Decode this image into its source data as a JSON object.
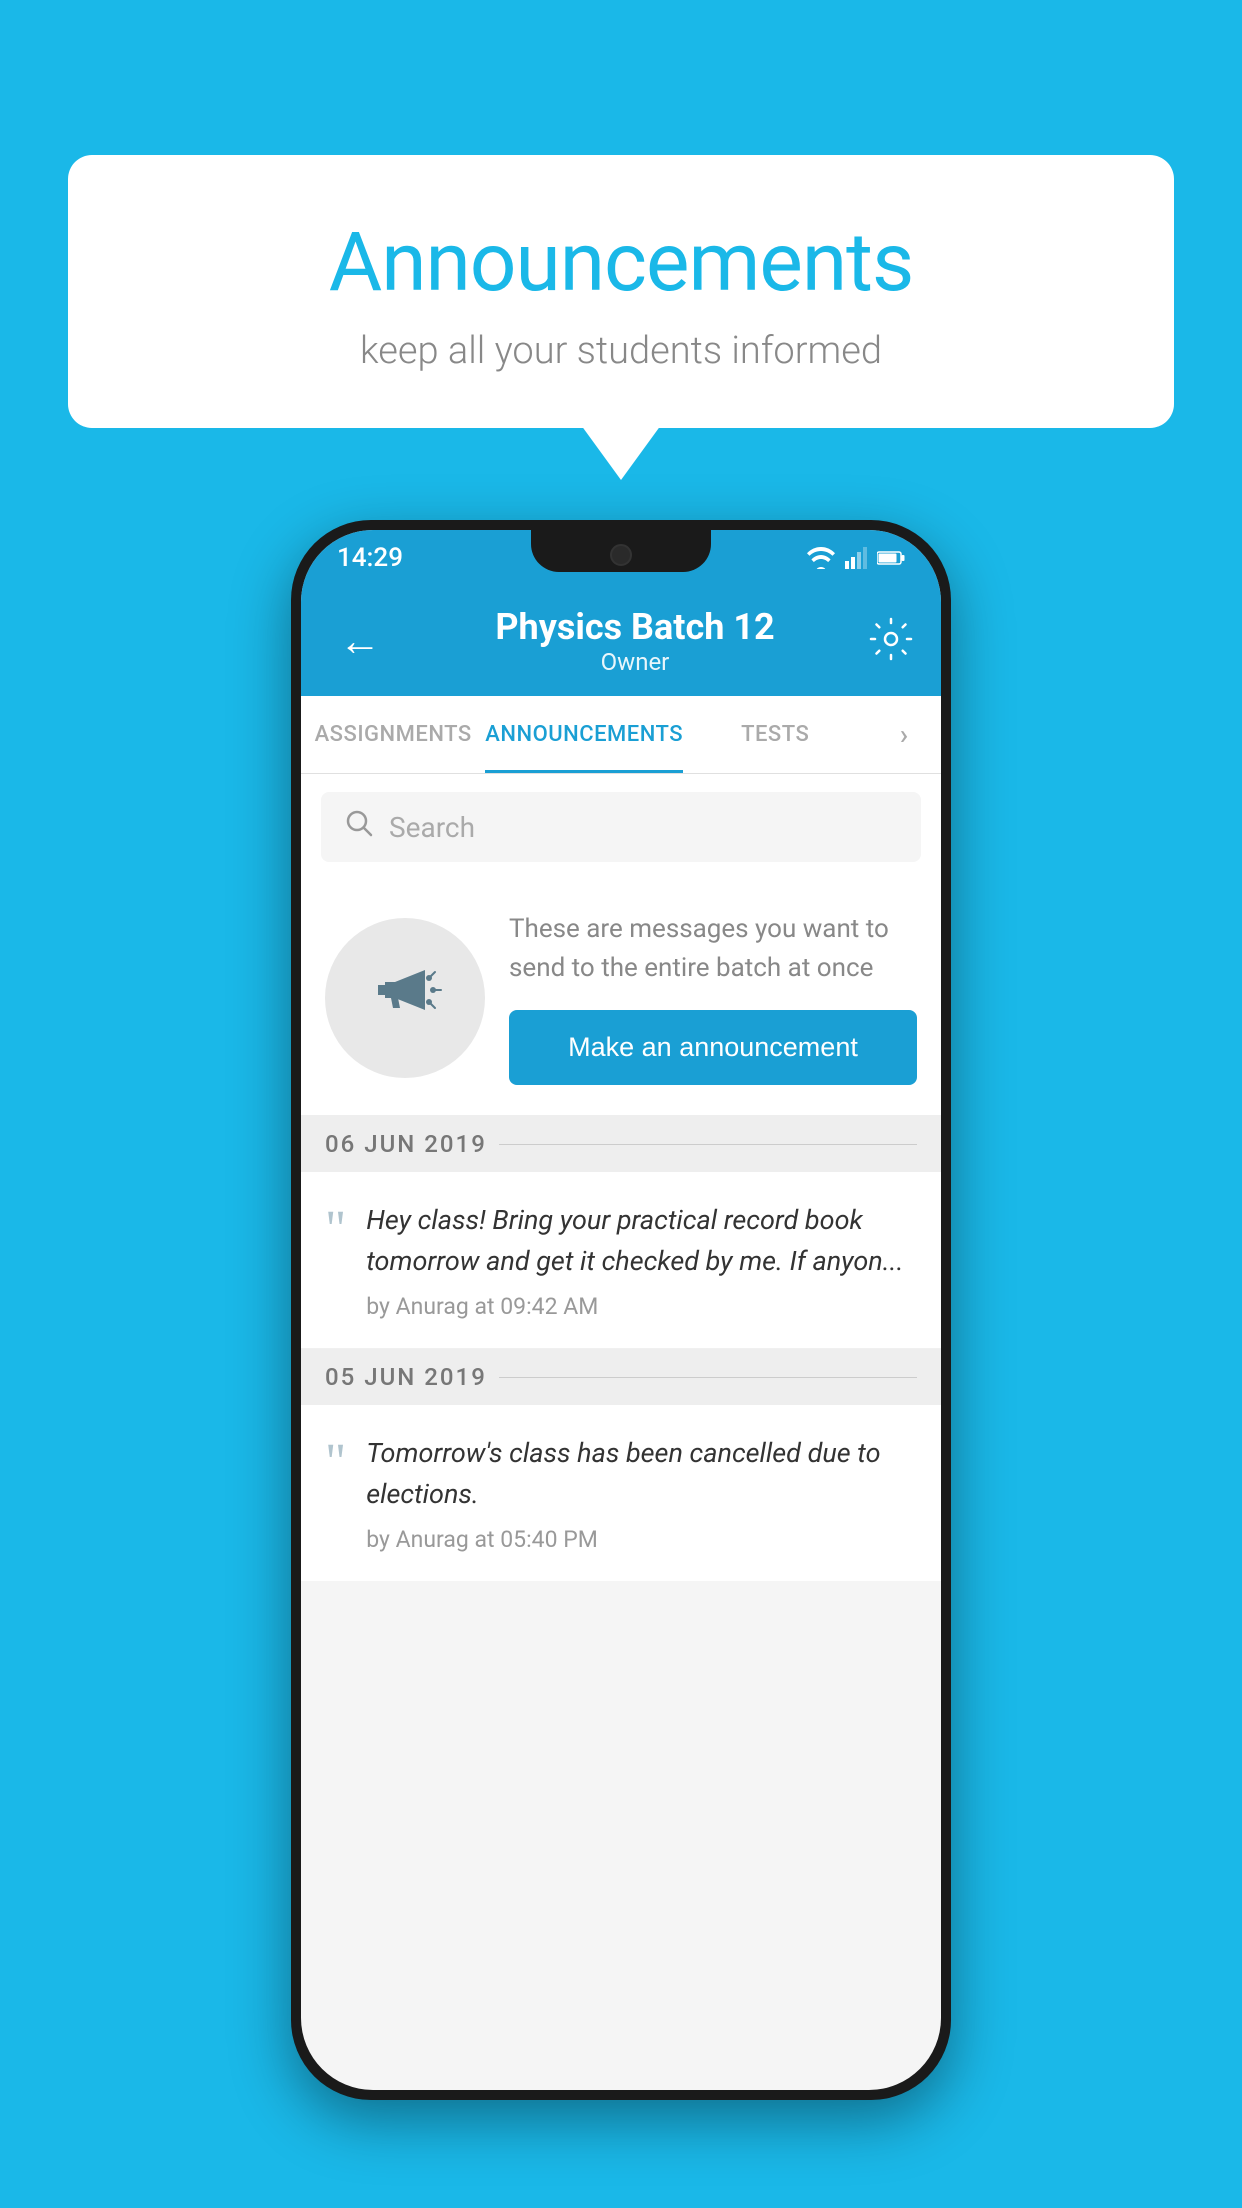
{
  "background_color": "#1ab8e8",
  "speech_bubble": {
    "title": "Announcements",
    "subtitle": "keep all your students informed"
  },
  "phone": {
    "status_bar": {
      "time": "14:29"
    },
    "app_bar": {
      "back_label": "←",
      "title": "Physics Batch 12",
      "subtitle": "Owner",
      "settings_label": "⚙"
    },
    "tabs": [
      {
        "label": "ASSIGNMENTS",
        "active": false
      },
      {
        "label": "ANNOUNCEMENTS",
        "active": true
      },
      {
        "label": "TESTS",
        "active": false
      },
      {
        "label": "...",
        "active": false
      }
    ],
    "search": {
      "placeholder": "Search"
    },
    "promo": {
      "description_text": "These are messages you want to send to the entire batch at once",
      "button_label": "Make an announcement"
    },
    "announcements": [
      {
        "date": "06  JUN  2019",
        "text": "Hey class! Bring your practical record book tomorrow and get it checked by me. If anyon...",
        "meta": "by Anurag at 09:42 AM"
      },
      {
        "date": "05  JUN  2019",
        "text": "Tomorrow's class has been cancelled due to elections.",
        "meta": "by Anurag at 05:40 PM"
      }
    ]
  }
}
